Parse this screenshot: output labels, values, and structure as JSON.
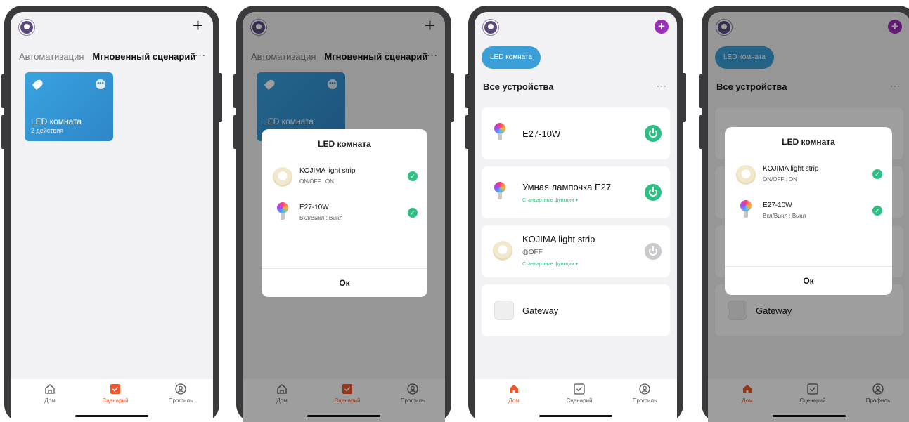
{
  "scenes_screen": {
    "tabs": [
      "Автоматизация",
      "Мгновенный сценарий"
    ],
    "more": "···",
    "add": "+",
    "card": {
      "name": "LED комната",
      "subtitle": "2 действия"
    }
  },
  "dialog": {
    "title": "LED комната",
    "items": [
      {
        "name": "KOJIMA light strip",
        "state": "ON/OFF : ON"
      },
      {
        "name": "E27-10W",
        "state": "Вкл/Выкл : Выкл"
      }
    ],
    "ok": "Ок"
  },
  "home_screen": {
    "room": "LED комната",
    "section": "Все устройства",
    "more": "···",
    "devices": [
      {
        "name": "E27-10W",
        "power": "on"
      },
      {
        "name": "Умная лампочка E27",
        "sub": "Стандартные функции ▾",
        "power": "on"
      },
      {
        "name": "KOJIMA light strip",
        "status": "◍OFF",
        "sub": "Стандартные функции ▾",
        "power": "off"
      },
      {
        "name": "Gateway"
      }
    ]
  },
  "nav": {
    "home": "Дом",
    "scenes": "Сценарий",
    "profile": "Профиль"
  },
  "colors": {
    "accent": "#f0562a",
    "green": "#2dbf84",
    "blue": "#3a9fd8",
    "plus": "#9b30b8"
  }
}
